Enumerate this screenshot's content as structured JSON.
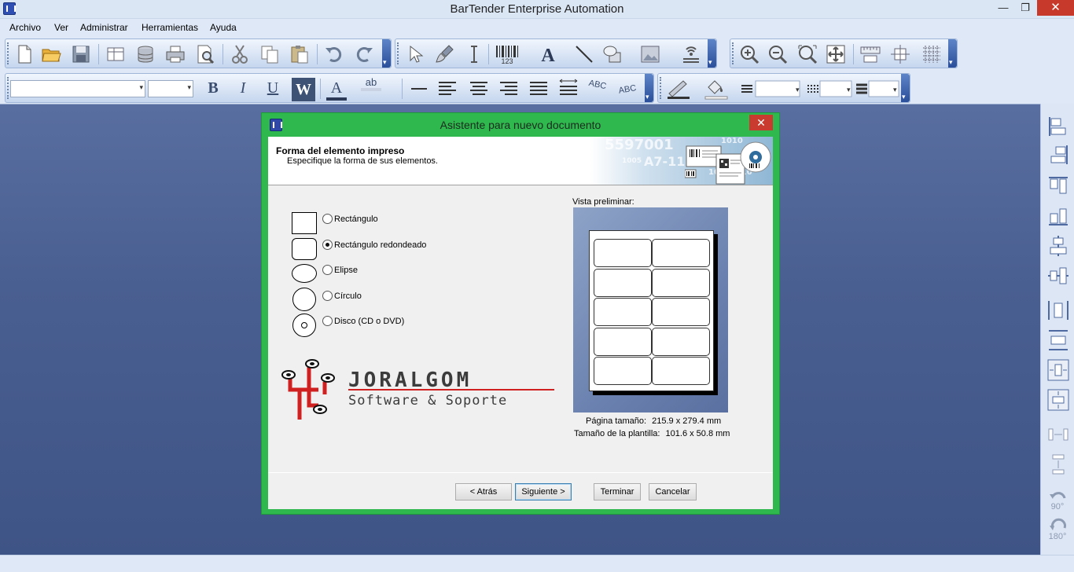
{
  "window": {
    "title": "BarTender Enterprise Automation",
    "minimize": "—",
    "restore": "❐",
    "close": "✕"
  },
  "menu": [
    "Archivo",
    "Ver",
    "Administrar",
    "Herramientas",
    "Ayuda"
  ],
  "toolbar": {
    "standard_icons": [
      "new-document-icon",
      "open-folder-icon",
      "save-icon",
      "page-setup-icon",
      "database-icon",
      "print-icon",
      "print-preview-icon",
      "cut-icon",
      "copy-icon",
      "paste-icon",
      "undo-icon",
      "redo-icon"
    ],
    "object_icons": [
      "pointer-icon",
      "paintbrush-icon",
      "text-cursor-icon",
      "barcode-icon",
      "text-tool-icon",
      "line-tool-icon",
      "shapes-tool-icon",
      "picture-tool-icon",
      "rfid-icon"
    ],
    "barcode_caption": "123",
    "zoom_icons": [
      "zoom-in-icon",
      "zoom-out-icon",
      "zoom-fit-icon",
      "zoom-full-icon",
      "ruler-icon",
      "snap-icon",
      "grid-icon"
    ],
    "format": {
      "bold": "B",
      "italic": "I",
      "underline": "U",
      "wordwrap": "W",
      "font_color": "A",
      "highlight": "ab",
      "abc1": "ABC",
      "abc2": "ABC"
    }
  },
  "sidebar": {
    "rotate90": "90°",
    "rotate180": "180°"
  },
  "dialog": {
    "title": "Asistente para nuevo documento",
    "close": "✕",
    "header_title": "Forma del elemento impreso",
    "header_subtitle": "Especifique la forma de sus elementos.",
    "banner_text_1": "5597001",
    "banner_text_2": "A7-118",
    "banner_text_3": "1010",
    "banner_text_4": "10101010",
    "banner_text_5": "1005",
    "options": [
      {
        "label": "Rectángulo",
        "selected": false
      },
      {
        "label": "Rectángulo redondeado",
        "selected": true
      },
      {
        "label": "Elipse",
        "selected": false
      },
      {
        "label": "Círculo",
        "selected": false
      },
      {
        "label": "Disco (CD o DVD)",
        "selected": false
      }
    ],
    "preview_label": "Vista preliminar:",
    "page_size_label": "Página tamaño:",
    "page_size_value": "215.9 x 279.4 mm",
    "template_size_label": "Tamaño de la plantilla:",
    "template_size_value": "101.6 x 50.8 mm",
    "preview_rows": 5,
    "preview_cols": 2,
    "logo": {
      "brand": "JORALGOM",
      "tagline": "Software & Soporte",
      "accent": "#d0201f",
      "dark": "#3c3c3c"
    },
    "buttons": {
      "back": "< Atrás",
      "next": "Siguiente >",
      "finish": "Terminar",
      "cancel": "Cancelar"
    }
  },
  "colors": {
    "dialog_frame": "#2fb84d",
    "workspace": "#4a5f91",
    "close_red": "#c83b2e"
  }
}
